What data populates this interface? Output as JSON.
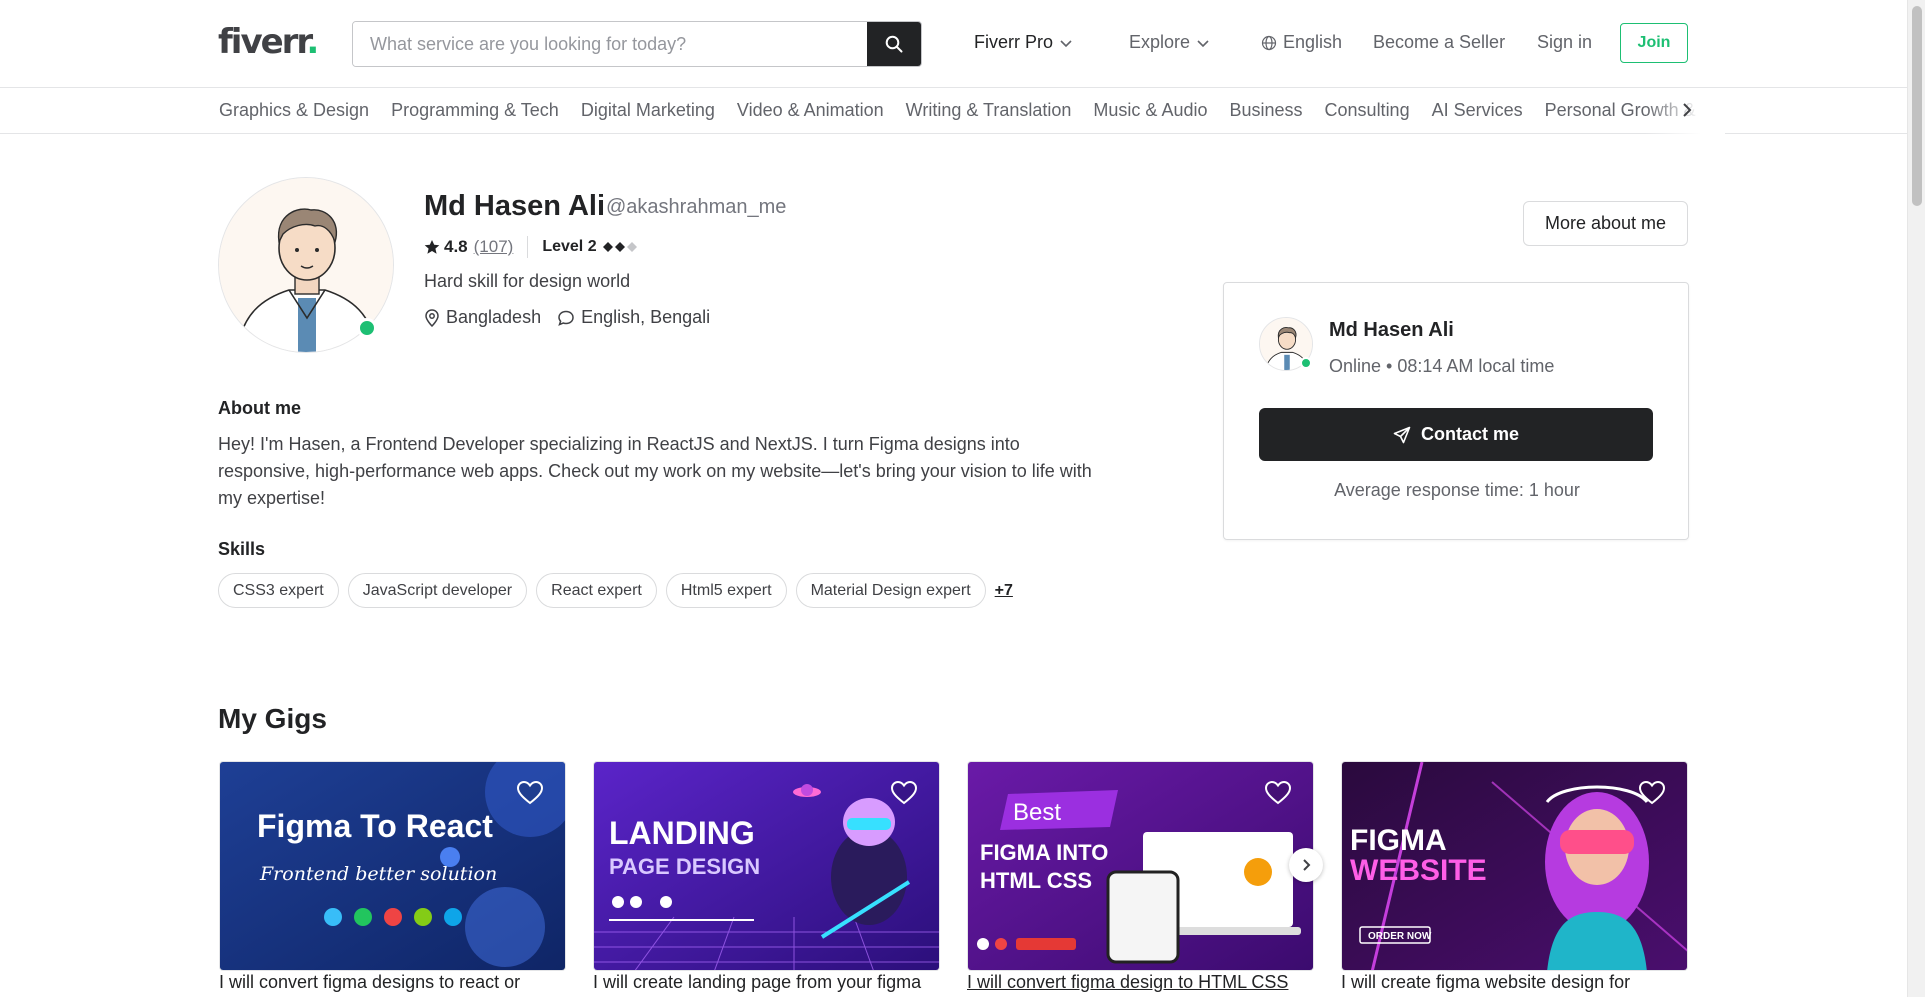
{
  "header": {
    "logo_text": "fiverr",
    "logo_dot": ".",
    "search_placeholder": "What service are you looking for today?",
    "nav": {
      "fiverr_pro": "Fiverr Pro",
      "explore": "Explore",
      "language": "English",
      "become_seller": "Become a Seller",
      "sign_in": "Sign in",
      "join": "Join"
    }
  },
  "categories": [
    "Graphics & Design",
    "Programming & Tech",
    "Digital Marketing",
    "Video & Animation",
    "Writing & Translation",
    "Music & Audio",
    "Business",
    "Consulting",
    "AI Services",
    "Personal Growth & Hobbies"
  ],
  "profile": {
    "name": "Md Hasen Ali",
    "username": "@akashrahman_me",
    "rating": "4.8",
    "review_count": "(107)",
    "level": "Level 2",
    "level_filled": 2,
    "level_total": 3,
    "tagline": "Hard skill for design world",
    "location": "Bangladesh",
    "languages": "English, Bengali",
    "online": true,
    "more_button": "More about me"
  },
  "about": {
    "title": "About me",
    "text": "Hey! I'm Hasen, a Frontend Developer specializing in ReactJS and NextJS. I turn Figma designs into responsive, high-performance web apps. Check out my work on my website—let's bring your vision to life with my expertise!"
  },
  "skills": {
    "title": "Skills",
    "items": [
      "CSS3 expert",
      "JavaScript developer",
      "React expert",
      "Html5 expert",
      "Material Design expert"
    ],
    "more": "+7"
  },
  "contact_card": {
    "name": "Md Hasen Ali",
    "status": "Online • 08:14 AM local time",
    "contact_button": "Contact me",
    "response": "Average response time: 1 hour"
  },
  "gigs": {
    "title": "My Gigs",
    "items": [
      {
        "title": "I will convert figma designs to react or",
        "image_text_1": "Figma To React",
        "image_text_2": "Frontend better solution"
      },
      {
        "title": "I will create landing page from your figma",
        "image_text_1": "LANDING",
        "image_text_2": "PAGE DESIGN"
      },
      {
        "title": "I will convert figma design to HTML CSS",
        "image_text_1": "Best",
        "image_text_2": "FIGMA INTO",
        "image_text_3": "HTML CSS"
      },
      {
        "title": "I will create figma website design for",
        "image_text_1": "FIGMA",
        "image_text_2": "WEBSITE",
        "image_text_3": "ORDER NOW"
      }
    ]
  },
  "colors": {
    "brand_green": "#1dbf73",
    "text_dark": "#222325",
    "button_dark": "#222325"
  }
}
